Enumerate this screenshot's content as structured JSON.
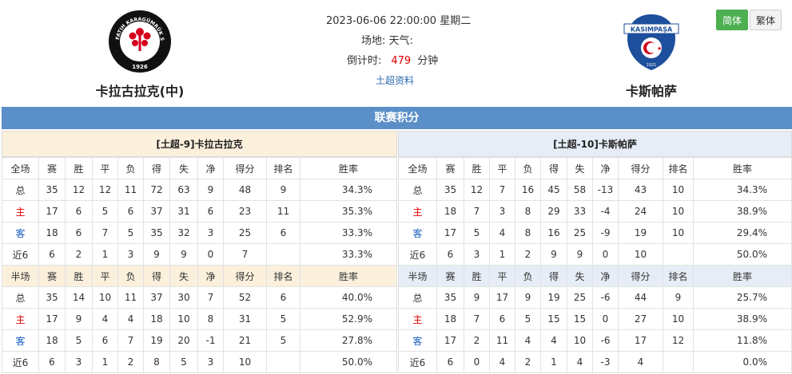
{
  "match": {
    "datetime": "2023-06-06 22:00:00 星期二",
    "venue_label": "场地:",
    "weather_label": "天气:",
    "countdown_label": "倒计时:",
    "countdown_value": "479",
    "countdown_unit": "分钟",
    "league_link": "土超资料"
  },
  "home_team": {
    "name": "卡拉古拉克(中)",
    "logo_top_text": "FATIH KARAGÜMRÜK SPOR KULÜBÜ",
    "logo_year": "1926"
  },
  "away_team": {
    "name": "卡斯帕萨",
    "logo_top_text": "KASIMPAŞA",
    "logo_year": "1921"
  },
  "lang": {
    "simplified": "简体",
    "traditional": "繁体"
  },
  "section_title": "联赛积分",
  "columns_full": [
    "全场",
    "赛",
    "胜",
    "平",
    "负",
    "得",
    "失",
    "净",
    "得分",
    "排名",
    "胜率"
  ],
  "columns_half": [
    "半场",
    "赛",
    "胜",
    "平",
    "负",
    "得",
    "失",
    "净",
    "得分",
    "排名",
    "胜率"
  ],
  "home_standings": {
    "title": "[土超-9]卡拉古拉克",
    "full": [
      [
        "总",
        "35",
        "12",
        "12",
        "11",
        "72",
        "63",
        "9",
        "48",
        "9",
        "34.3%"
      ],
      [
        "主",
        "17",
        "6",
        "5",
        "6",
        "37",
        "31",
        "6",
        "23",
        "11",
        "35.3%"
      ],
      [
        "客",
        "18",
        "6",
        "7",
        "5",
        "35",
        "32",
        "3",
        "25",
        "6",
        "33.3%"
      ],
      [
        "近6",
        "6",
        "2",
        "1",
        "3",
        "9",
        "9",
        "0",
        "7",
        "",
        "33.3%"
      ]
    ],
    "half": [
      [
        "总",
        "35",
        "14",
        "10",
        "11",
        "37",
        "30",
        "7",
        "52",
        "6",
        "40.0%"
      ],
      [
        "主",
        "17",
        "9",
        "4",
        "4",
        "18",
        "10",
        "8",
        "31",
        "5",
        "52.9%"
      ],
      [
        "客",
        "18",
        "5",
        "6",
        "7",
        "19",
        "20",
        "-1",
        "21",
        "5",
        "27.8%"
      ],
      [
        "近6",
        "6",
        "3",
        "1",
        "2",
        "8",
        "5",
        "3",
        "10",
        "",
        "50.0%"
      ]
    ]
  },
  "away_standings": {
    "title": "[土超-10]卡斯帕萨",
    "full": [
      [
        "总",
        "35",
        "12",
        "7",
        "16",
        "45",
        "58",
        "-13",
        "43",
        "10",
        "34.3%"
      ],
      [
        "主",
        "18",
        "7",
        "3",
        "8",
        "29",
        "33",
        "-4",
        "24",
        "10",
        "38.9%"
      ],
      [
        "客",
        "17",
        "5",
        "4",
        "8",
        "16",
        "25",
        "-9",
        "19",
        "10",
        "29.4%"
      ],
      [
        "近6",
        "6",
        "3",
        "1",
        "2",
        "9",
        "9",
        "0",
        "10",
        "",
        "50.0%"
      ]
    ],
    "half": [
      [
        "总",
        "35",
        "9",
        "17",
        "9",
        "19",
        "25",
        "-6",
        "44",
        "9",
        "25.7%"
      ],
      [
        "主",
        "18",
        "7",
        "6",
        "5",
        "15",
        "15",
        "0",
        "27",
        "10",
        "38.9%"
      ],
      [
        "客",
        "17",
        "2",
        "11",
        "4",
        "4",
        "10",
        "-6",
        "17",
        "12",
        "11.8%"
      ],
      [
        "近6",
        "6",
        "0",
        "4",
        "2",
        "1",
        "4",
        "-3",
        "4",
        "",
        "0.0%"
      ]
    ]
  },
  "colors": {
    "title_bar": "#5b8fc7",
    "home_accent": "#e00000",
    "away_accent": "#1a5fc0",
    "lang_active": "#4caf50"
  }
}
